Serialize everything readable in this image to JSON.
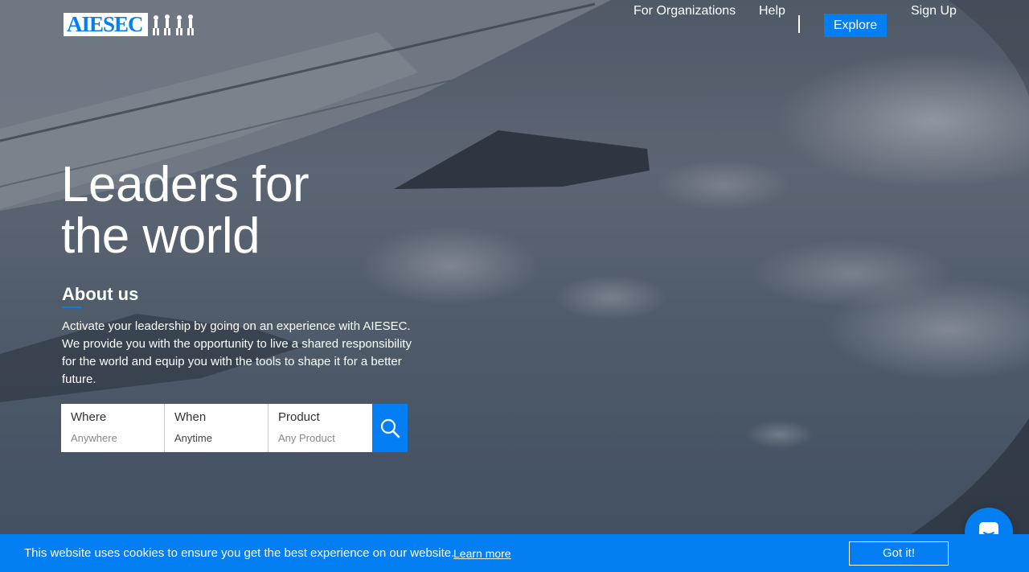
{
  "brand": {
    "logo_text": "AIESEC",
    "accent_color": "#037ef3"
  },
  "nav": {
    "for_organizations": "For Organizations",
    "help": "Help",
    "explore": "Explore",
    "sign_up": "Sign Up"
  },
  "hero": {
    "title_line1": "Leaders for",
    "title_line2": "the world",
    "about_heading": "About us",
    "about_text": "Activate your leadership by going on an experience with AIESEC. We provide you with the opportunity to live a shared responsibility for the world and equip you with the tools to shape it for a better future."
  },
  "search": {
    "where_label": "Where",
    "where_value": "Anywhere",
    "when_label": "When",
    "when_value": "Anytime",
    "product_label": "Product",
    "product_value": "Any Product",
    "button_icon": "search-icon"
  },
  "chat": {
    "icon": "chat-icon"
  },
  "cookie": {
    "message": "This website uses cookies to ensure you get the best experience on our website.",
    "learn_more": "Learn more",
    "accept": "Got it!"
  }
}
